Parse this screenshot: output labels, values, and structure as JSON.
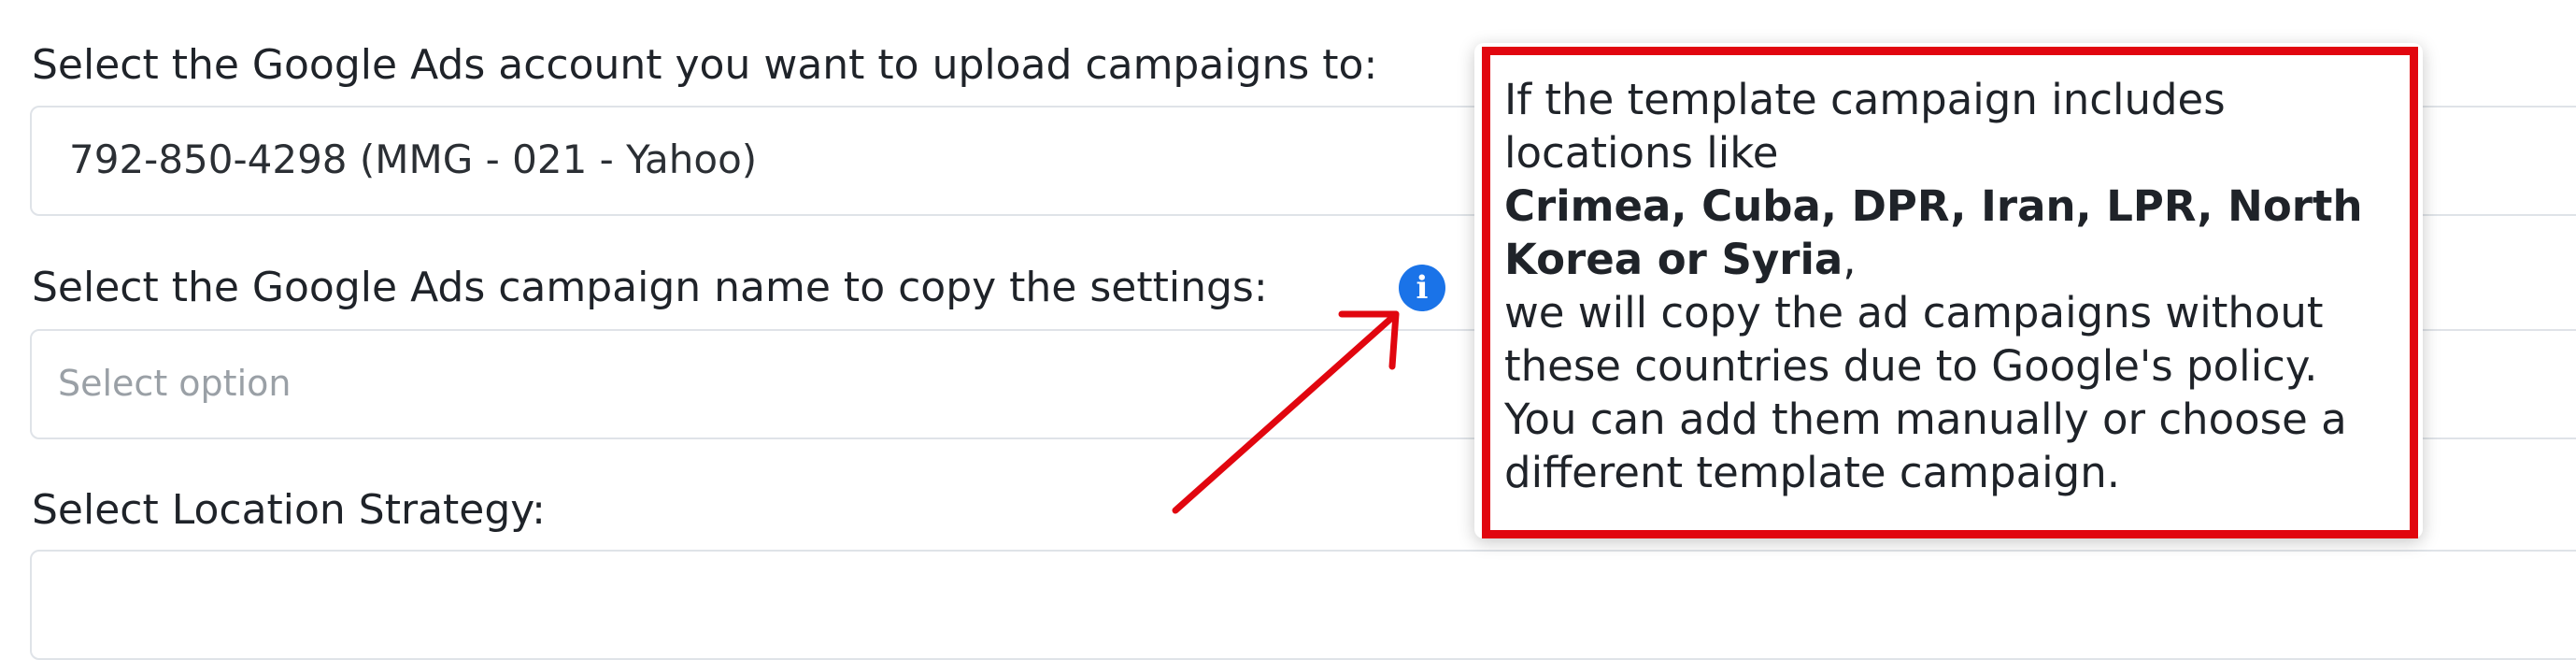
{
  "account_field": {
    "label": "Select the Google Ads account you want to upload campaigns to:",
    "value": "792-850-4298 (MMG - 021 - Yahoo)"
  },
  "campaign_field": {
    "label": "Select the Google Ads campaign name to copy the settings:",
    "placeholder": "Select option",
    "info_icon": "info-circle-icon",
    "info_glyph": "i"
  },
  "location_field": {
    "label": "Select Location Strategy:"
  },
  "tooltip": {
    "intro": "If the template campaign includes locations like",
    "countries": "Crimea, Cuba, DPR, Iran, LPR, North Korea or Syria",
    "countries_suffix": ",",
    "body": "we will copy the ad campaigns without these countries due to Google's policy. You can add them manually or choose a different template campaign."
  },
  "annotation": {
    "highlight_color": "#e1060f",
    "arrow_color": "#e1060f"
  },
  "colors": {
    "info_icon": "#1a73e8",
    "text": "#1f2329",
    "placeholder": "#9aa0a6",
    "field_border": "#dfe3e8"
  }
}
